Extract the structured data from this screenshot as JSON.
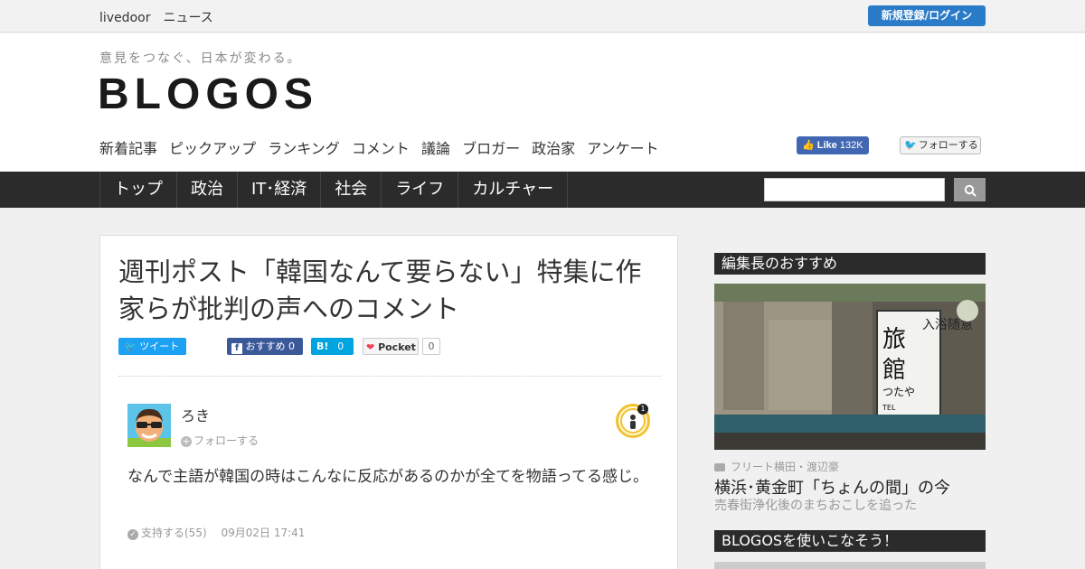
{
  "topbar": {
    "brand": "livedoor　ニュース",
    "login_label": "新規登録/ログイン"
  },
  "header": {
    "tagline": "意見をつなぐ、日本が変わる。",
    "logo": "BLOGOS",
    "subnav": [
      "新着記事",
      "ピックアップ",
      "ランキング",
      "コメント",
      "議論",
      "ブロガー",
      "政治家",
      "アンケート"
    ],
    "fb_like_label": "Like",
    "fb_like_count": "132K",
    "tw_follow_label": "フォローする"
  },
  "nav": {
    "items": [
      "トップ",
      "政治",
      "IT･経済",
      "社会",
      "ライフ",
      "カルチャー"
    ],
    "search_placeholder": ""
  },
  "article": {
    "title": "週刊ポスト「韓国なんて要らない」特集に作家らが批判の声へのコメント",
    "share": {
      "tweet": "ツイート",
      "fb_label": "おすすめ",
      "fb_count": "0",
      "hatena_label": "B!",
      "hatena_count": "0",
      "pocket_label": "Pocket",
      "pocket_count": "0"
    },
    "comment": {
      "author": "ろき",
      "follow_label": "フォローする",
      "badge_count": "1",
      "text": "なんで主語が韓国の時はこんなに反応があるのかが全てを物語ってる感じ。",
      "support": "支持する(55)",
      "date": "09月02日 17:41"
    }
  },
  "sidebar": {
    "editor_pick_heading": "編集長のおすすめ",
    "photo_credit": "フリート横田・渡辺豪",
    "pick_title": "横浜･黄金町「ちょんの間」の今",
    "pick_subtitle": "売春街浄化後のまちおこしを追った",
    "sign_text": "入浴随意 旅館 つたや TEL",
    "how_to_heading": "BLOGOSを使いこなそう！"
  },
  "colors": {
    "accent_blue": "#2a7bc8",
    "nav_bg": "#2b2b2b",
    "twitter": "#1da1f2",
    "facebook": "#3b5998",
    "hatena": "#00a4de",
    "pocket": "#ef4056"
  }
}
